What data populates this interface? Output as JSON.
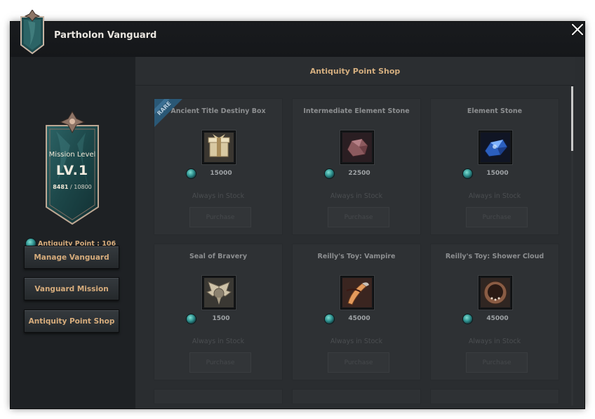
{
  "window": {
    "title": "Partholon Vanguard",
    "close_icon": "close-x-icon"
  },
  "vanguard": {
    "mission_level_label": "Mission Level",
    "level": "LV.1",
    "xp_current": "8481",
    "xp_separator": "/",
    "xp_max": "10800",
    "antiquity_point_text": "Antiquity Point : 106"
  },
  "nav": {
    "buttons": [
      {
        "label": "Manage Vanguard"
      },
      {
        "label": "Vanguard Mission"
      },
      {
        "label": "Antiquity Point Shop"
      }
    ]
  },
  "shop": {
    "title": "Antiquity Point Shop",
    "rare_badge": "RARE",
    "items": [
      {
        "name": "Ancient Title Destiny Box",
        "price": "15000",
        "stock": "Always in Stock",
        "button": "Purchase",
        "icon": "gift-box-icon",
        "rare": true
      },
      {
        "name": "Intermediate Element Stone",
        "price": "22500",
        "stock": "Always in Stock",
        "button": "Purchase",
        "icon": "stone-icon",
        "rare": false
      },
      {
        "name": "Element Stone",
        "price": "15000",
        "stock": "Always in Stock",
        "button": "Purchase",
        "icon": "blue-crystal-icon",
        "rare": false
      },
      {
        "name": "Seal of Bravery",
        "price": "1500",
        "stock": "Always in Stock",
        "button": "Purchase",
        "icon": "winged-seal-icon",
        "rare": false
      },
      {
        "name": "Reilly's Toy: Vampire",
        "price": "45000",
        "stock": "Always in Stock",
        "button": "Purchase",
        "icon": "vampire-toy-icon",
        "rare": false
      },
      {
        "name": "Reilly's Toy: Shower Cloud",
        "price": "45000",
        "stock": "Always in Stock",
        "button": "Purchase",
        "icon": "shower-cloud-toy-icon",
        "rare": false
      }
    ]
  },
  "colors": {
    "accent": "#d6ac7c",
    "panel_bg": "#1e2124",
    "shop_bg": "#2a2d30",
    "teal_gem": "#2d8f8d"
  }
}
